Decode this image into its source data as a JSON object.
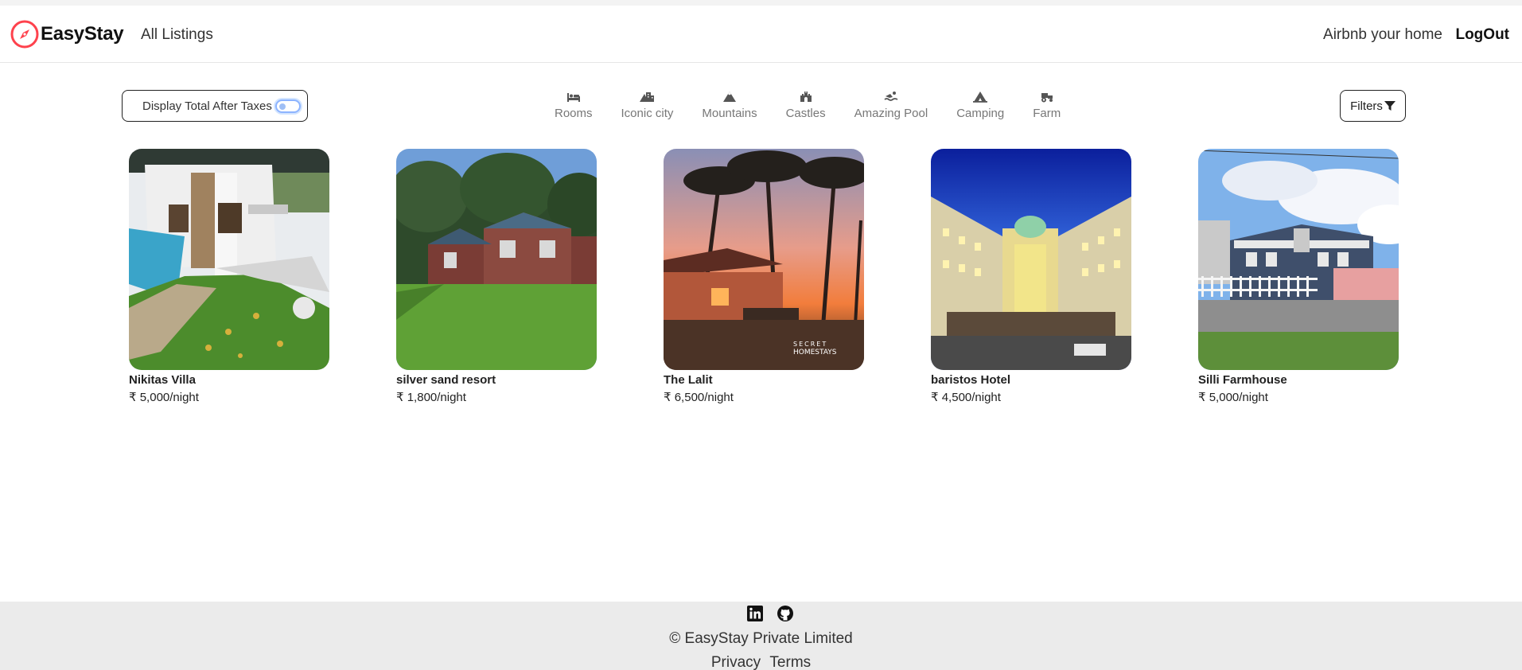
{
  "brand": {
    "name": "EasyStay",
    "accent_color": "#fe424d"
  },
  "nav": {
    "all_listings": "All Listings",
    "host": "Airbnb your home",
    "logout": "LogOut"
  },
  "tax_toggle": {
    "label": "Display Total After Taxes",
    "enabled": false
  },
  "filters": [
    {
      "label": "Rooms",
      "icon": "bed-icon"
    },
    {
      "label": "Iconic city",
      "icon": "city-icon"
    },
    {
      "label": "Mountains",
      "icon": "mountain-icon"
    },
    {
      "label": "Castles",
      "icon": "castle-icon"
    },
    {
      "label": "Amazing Pool",
      "icon": "pool-icon"
    },
    {
      "label": "Camping",
      "icon": "campground-icon"
    },
    {
      "label": "Farm",
      "icon": "tractor-icon"
    }
  ],
  "filters_button": {
    "label": "Filters",
    "icon": "filter-icon"
  },
  "listings": [
    {
      "title": "Nikitas Villa",
      "price": "₹ 5,000/night"
    },
    {
      "title": "silver sand resort",
      "price": "₹ 1,800/night"
    },
    {
      "title": "The Lalit",
      "price": "₹ 6,500/night"
    },
    {
      "title": "baristos Hotel",
      "price": "₹ 4,500/night"
    },
    {
      "title": "Silli Farmhouse",
      "price": "₹ 5,000/night"
    }
  ],
  "footer": {
    "socials": [
      "linkedin-icon",
      "github-icon"
    ],
    "copyright": "© EasyStay Private Limited",
    "privacy": "Privacy",
    "terms": "Terms"
  }
}
